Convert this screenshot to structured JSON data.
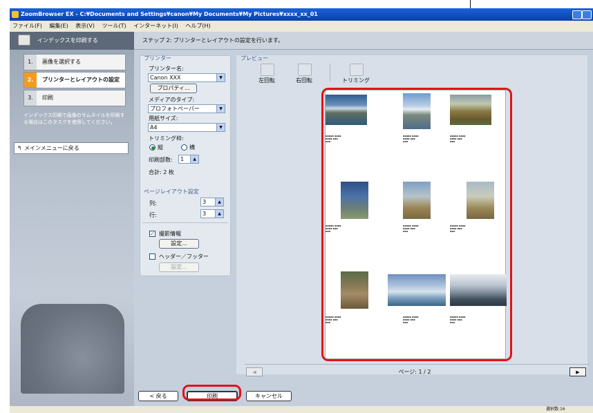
{
  "window": {
    "title": "ZoomBrowser EX  -  C:¥Documents and Settings¥canon¥My Documents¥My Pictures¥xxxx_xx_01"
  },
  "menubar": {
    "items": [
      "ファイル(F)",
      "編集(E)",
      "表示(V)",
      "ツール(T)",
      "インターネット(I)",
      "ヘルプ(H)"
    ]
  },
  "sidebar": {
    "header": "インデックスを印刷する",
    "steps": [
      {
        "num": "1.",
        "label": "画像を選択する"
      },
      {
        "num": "2.",
        "label": "プリンターとレイアウトの設定"
      },
      {
        "num": "3.",
        "label": "印刷"
      }
    ],
    "hint": "インデックス印刷で画像のサムネイルを印刷する場合はこのタスクを使用してください。",
    "main_menu_button": "メインメニューに戻る"
  },
  "step_header": "ステップ 2: プリンターとレイアウトの設定を行います。",
  "printer": {
    "group_title": "プリンター",
    "printer_name_label": "プリンター名:",
    "printer_name_value": "Canon XXX",
    "properties_button": "プロパティ...",
    "media_type_label": "メディアのタイプ:",
    "media_type_value": "プロフォトペーパー",
    "paper_size_label": "用紙サイズ:",
    "paper_size_value": "A4",
    "trimming_label": "トリミング枠:",
    "orientation_portrait": "縦",
    "orientation_landscape": "横",
    "copies_label": "印刷部数:",
    "copies_value": "1",
    "total_label": "合計: 2 枚"
  },
  "layout": {
    "group_title": "ページレイアウト設定",
    "columns_label": "列:",
    "columns_value": "3",
    "rows_label": "行:",
    "rows_value": "3",
    "shooting_info_label": "撮影情報",
    "shooting_info_checked": true,
    "shooting_info_settings_button": "設定...",
    "header_footer_label": "ヘッダー／フッター",
    "header_footer_checked": false,
    "header_footer_settings_button": "設定..."
  },
  "preview": {
    "group_title": "プレビュー",
    "tools": [
      "左回転",
      "右回転",
      "トリミング"
    ],
    "page_label": "ページ: 1 / 2"
  },
  "buttons": {
    "back": "< 戻る",
    "print": "印刷",
    "cancel": "キャンセル"
  },
  "status": {
    "selected_count": "選択数:16"
  },
  "colors": {
    "callout_red": "#e0131a",
    "active_step_accent": "#f59b1b",
    "titlebar_blue": "#0a3fb0"
  }
}
